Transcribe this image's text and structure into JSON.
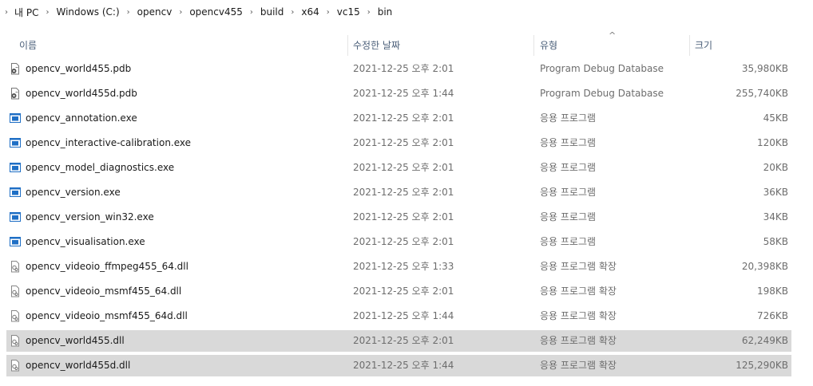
{
  "breadcrumb": [
    "내 PC",
    "Windows (C:)",
    "opencv",
    "opencv455",
    "build",
    "x64",
    "vc15",
    "bin"
  ],
  "columns": {
    "name": "이름",
    "date": "수정한 날짜",
    "type": "유형",
    "size": "크기"
  },
  "files": [
    {
      "name": "opencv_world455.pdb",
      "date": "2021-12-25 오후 2:01",
      "type": "Program Debug Database",
      "size": "35,980KB",
      "icon": "pdb-file-icon"
    },
    {
      "name": "opencv_world455d.pdb",
      "date": "2021-12-25 오후 1:44",
      "type": "Program Debug Database",
      "size": "255,740KB",
      "icon": "pdb-file-icon"
    },
    {
      "name": "opencv_annotation.exe",
      "date": "2021-12-25 오후 2:01",
      "type": "응용 프로그램",
      "size": "45KB",
      "icon": "exe-file-icon"
    },
    {
      "name": "opencv_interactive-calibration.exe",
      "date": "2021-12-25 오후 2:01",
      "type": "응용 프로그램",
      "size": "120KB",
      "icon": "exe-file-icon"
    },
    {
      "name": "opencv_model_diagnostics.exe",
      "date": "2021-12-25 오후 2:01",
      "type": "응용 프로그램",
      "size": "20KB",
      "icon": "exe-file-icon"
    },
    {
      "name": "opencv_version.exe",
      "date": "2021-12-25 오후 2:01",
      "type": "응용 프로그램",
      "size": "36KB",
      "icon": "exe-file-icon"
    },
    {
      "name": "opencv_version_win32.exe",
      "date": "2021-12-25 오후 2:01",
      "type": "응용 프로그램",
      "size": "34KB",
      "icon": "exe-file-icon"
    },
    {
      "name": "opencv_visualisation.exe",
      "date": "2021-12-25 오후 2:01",
      "type": "응용 프로그램",
      "size": "58KB",
      "icon": "exe-file-icon"
    },
    {
      "name": "opencv_videoio_ffmpeg455_64.dll",
      "date": "2021-12-25 오후 1:33",
      "type": "응용 프로그램 확장",
      "size": "20,398KB",
      "icon": "dll-file-icon"
    },
    {
      "name": "opencv_videoio_msmf455_64.dll",
      "date": "2021-12-25 오후 2:01",
      "type": "응용 프로그램 확장",
      "size": "198KB",
      "icon": "dll-file-icon"
    },
    {
      "name": "opencv_videoio_msmf455_64d.dll",
      "date": "2021-12-25 오후 1:44",
      "type": "응용 프로그램 확장",
      "size": "726KB",
      "icon": "dll-file-icon"
    },
    {
      "name": "opencv_world455.dll",
      "date": "2021-12-25 오후 2:01",
      "type": "응용 프로그램 확장",
      "size": "62,249KB",
      "icon": "dll-file-icon",
      "selected": true
    },
    {
      "name": "opencv_world455d.dll",
      "date": "2021-12-25 오후 1:44",
      "type": "응용 프로그램 확장",
      "size": "125,290KB",
      "icon": "dll-file-icon",
      "selected": true
    }
  ],
  "colors": {
    "selection": "#d9d9d9",
    "header_text": "#4c607a",
    "exe_icon_blue": "#1f6fc5"
  }
}
